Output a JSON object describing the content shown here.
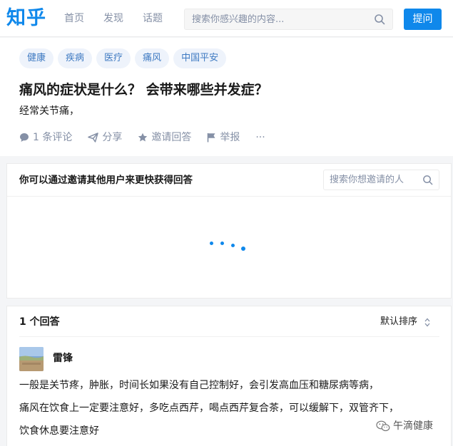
{
  "header": {
    "logo": "知乎",
    "nav": [
      "首页",
      "发现",
      "话题"
    ],
    "search_placeholder": "搜索你感兴趣的内容...",
    "ask_label": "提问"
  },
  "question": {
    "tags": [
      "健康",
      "疾病",
      "医疗",
      "痛风",
      "中国平安"
    ],
    "title": "痛风的症状是什么？ 会带来哪些并发症？",
    "description": "经常关节痛，",
    "actions": {
      "comments": "1 条评论",
      "share": "分享",
      "invite": "邀请回答",
      "report": "举报",
      "more": "···"
    }
  },
  "invite": {
    "title": "你可以通过邀请其他用户来更快获得回答",
    "search_placeholder": "搜索你想邀请的人"
  },
  "answers": {
    "count_label": "1 个回答",
    "sort_label": "默认排序",
    "author": "雷锋",
    "lines": [
      "一般是关节疼，肿胀，时间长如果没有自己控制好，会引发高血压和糖尿病等病，",
      "痛风在饮食上一定要注意好，多吃点西芹，喝点西芹复合茶，可以缓解下，双管齐下，",
      "饮食休息要注意好"
    ]
  },
  "watermark": "午滴健康",
  "colors": {
    "brand": "#0f88eb",
    "muted": "#8590a6",
    "tag_bg": "#eef3fb",
    "tag_text": "#3e7ac2"
  }
}
